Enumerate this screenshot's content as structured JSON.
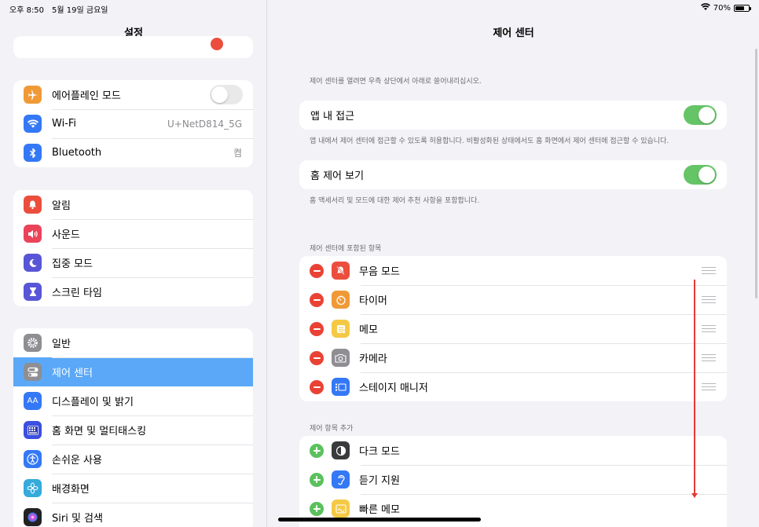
{
  "status": {
    "time": "오후 8:50",
    "date": "5월 19일 금요일",
    "battery": "70%",
    "battery_level": 0.7
  },
  "sidebar": {
    "title": "설정",
    "group1": [
      {
        "label": "에어플레인 모드",
        "icon": "airplane-icon",
        "color": "#f09a37",
        "toggle": false
      },
      {
        "label": "Wi-Fi",
        "icon": "wifi-icon",
        "color": "#3478f6",
        "value": "U+NetD814_5G"
      },
      {
        "label": "Bluetooth",
        "icon": "bluetooth-icon",
        "color": "#3478f6",
        "value": "켬"
      }
    ],
    "group2": [
      {
        "label": "알림",
        "icon": "bell-icon",
        "color": "#eb4e3d"
      },
      {
        "label": "사운드",
        "icon": "speaker-icon",
        "color": "#eb445a"
      },
      {
        "label": "집중 모드",
        "icon": "moon-icon",
        "color": "#5856d6"
      },
      {
        "label": "스크린 타임",
        "icon": "hourglass-icon",
        "color": "#5856d6"
      }
    ],
    "group3": [
      {
        "label": "일반",
        "icon": "gear-icon",
        "color": "#8e8e93"
      },
      {
        "label": "제어 센터",
        "icon": "switches-icon",
        "color": "#8e8e93",
        "selected": true
      },
      {
        "label": "디스플레이 및 밝기",
        "icon": "text-size-icon",
        "color": "#3478f6"
      },
      {
        "label": "홈 화면 및 멀티태스킹",
        "icon": "grid-icon",
        "color": "#3c4fe0"
      },
      {
        "label": "손쉬운 사용",
        "icon": "accessibility-icon",
        "color": "#3478f6"
      },
      {
        "label": "배경화면",
        "icon": "flower-icon",
        "color": "#35aadc"
      },
      {
        "label": "Siri 및 검색",
        "icon": "siri-icon",
        "color": "#222222"
      }
    ]
  },
  "main": {
    "title": "제어 센터",
    "intro": "제어 센터를 열려면 우측 상단에서 아래로 쓸어내리십시오.",
    "access_in_apps": {
      "label": "앱 내 접근",
      "toggle": true,
      "caption": "앱 내에서 제어 센터에 접근할 수 있도록 허용합니다. 비활성화된 상태에서도 홈 화면에서 제어 센터에 접근할 수 있습니다."
    },
    "home_controls": {
      "label": "홈 제어 보기",
      "toggle": true,
      "caption": "홈 액세서리 및 모드에 대한 제어 추천 사항을 포함합니다."
    },
    "included_header": "제어 센터에 포함된 항목",
    "included": [
      {
        "label": "무음 모드",
        "icon": "bell-slash-icon",
        "color": "#eb4e3d"
      },
      {
        "label": "타이머",
        "icon": "timer-icon",
        "color": "#f09a37"
      },
      {
        "label": "메모",
        "icon": "notes-icon",
        "color": "#f5c945"
      },
      {
        "label": "카메라",
        "icon": "camera-icon",
        "color": "#8e8e93"
      },
      {
        "label": "스테이지 매니저",
        "icon": "stage-manager-icon",
        "color": "#3478f6"
      }
    ],
    "more_header": "제어 항목 추가",
    "more": [
      {
        "label": "다크 모드",
        "icon": "dark-mode-icon",
        "color": "#3a3a3c"
      },
      {
        "label": "듣기 지원",
        "icon": "ear-icon",
        "color": "#3478f6"
      },
      {
        "label": "빠른 메모",
        "icon": "quick-note-icon",
        "color": "#f5c945"
      }
    ]
  }
}
